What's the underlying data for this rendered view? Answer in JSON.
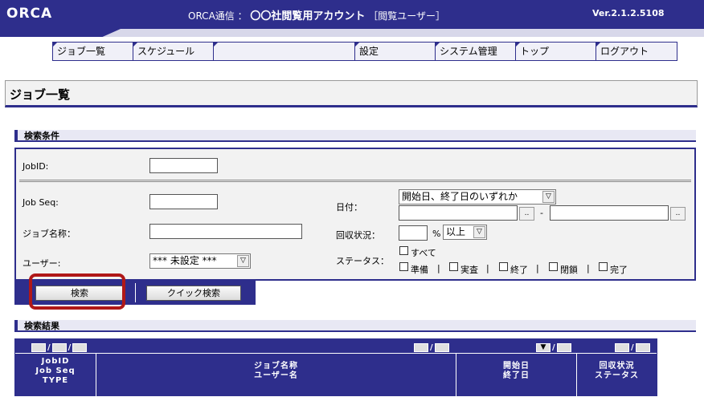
{
  "header": {
    "logo": "ORCA",
    "title_prefix": "ORCA通信 ：",
    "company": "〇〇社閲覧用アカウント",
    "role": "［閲覧ユーザー］",
    "version": "Ver.2.1.2.5108"
  },
  "nav": {
    "items": [
      "ジョブ一覧",
      "スケジュール",
      "",
      "設定",
      "システム管理",
      "トップ",
      "ログアウト"
    ]
  },
  "page_title": "ジョブ一覧",
  "search_section": {
    "title": "検索条件",
    "jobid_label": "JobID:",
    "jobseq_label": "Job Seq:",
    "jobname_label": "ジョブ名称：",
    "user_label": "ユーザー:",
    "user_select": "*** 未設定 ***",
    "date_label": "日付：",
    "date_select": "開始日、終了日のいずれか",
    "date_sep": "-",
    "dots": "..",
    "collect_label": "回収状況：",
    "percent": "%",
    "collect_select": "以上",
    "status_label": "ステータス：",
    "status_all": "すべて",
    "status_options": [
      "準備",
      "実査",
      "終了",
      "閉鎖",
      "完了"
    ],
    "status_sep": "|"
  },
  "buttons": {
    "search": "検索",
    "quick_search": "クイック検索"
  },
  "results_section": {
    "title": "検索結果",
    "columns": {
      "c1": [
        "JobID",
        "Job Seq",
        "TYPE"
      ],
      "c2": [
        "ジョブ名称",
        "ユーザー名"
      ],
      "c3": [
        "開始日",
        "終了日"
      ],
      "c4": [
        "回収状況",
        "ステータス"
      ]
    },
    "sort_slash": "/",
    "sort_arrow": "▼"
  }
}
